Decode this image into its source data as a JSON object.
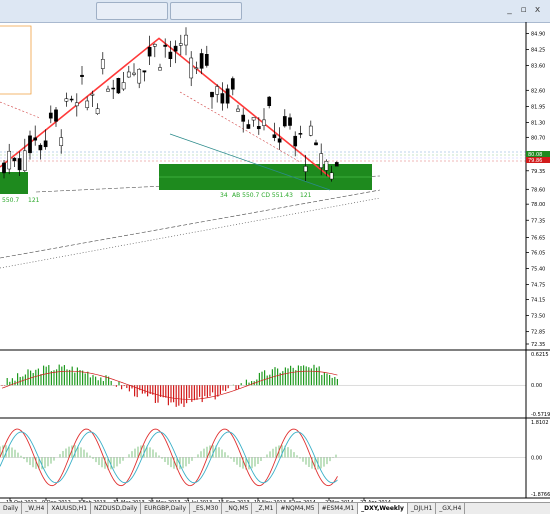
{
  "window": {
    "controls": {
      "minimize": "_",
      "restore": "▫",
      "close": "x"
    }
  },
  "tabs": [
    {
      "label": "Daily"
    },
    {
      "label": "_W,H4"
    },
    {
      "label": "XAUUSD,H1"
    },
    {
      "label": "NZDUSD,Daily"
    },
    {
      "label": "EURGBP,Daily"
    },
    {
      "label": "_ES,M30"
    },
    {
      "label": "_NQ,M5"
    },
    {
      "label": "_Z,M1"
    },
    {
      "label": "#NQM4,M5"
    },
    {
      "label": "#ESM4,M1"
    },
    {
      "label": "_DXY,Weekly",
      "active": true
    },
    {
      "label": "_DJI,H1"
    },
    {
      "label": "_GX,H4"
    }
  ],
  "chart_data": [
    {
      "type": "candlestick",
      "price_axis_ticks": [
        "84.90",
        "84.25",
        "83.60",
        "82.60",
        "81.95",
        "81.30",
        "80.70",
        "80.00",
        "79.35",
        "78.60",
        "78.00",
        "77.35",
        "76.65",
        "76.05",
        "75.40",
        "74.75",
        "74.15",
        "73.50",
        "72.85",
        "72.35"
      ],
      "ylim": [
        72.35,
        85.2
      ],
      "current_price_label_1": "80.08",
      "current_price_label_2": "79.86",
      "annotations": [
        "550.7",
        "121",
        "34",
        "AB 550.7 CD 551.43",
        "121"
      ],
      "zigzag": [
        {
          "date": "Jul 2012",
          "price": 79.5
        },
        {
          "date": "26 May 2013",
          "price": 84.7
        },
        {
          "date": "27 Apr 2014",
          "price": 79.1
        }
      ],
      "colors": {
        "up_candle": "#ffffff",
        "down_candle": "#000000",
        "zigzag": "#ff3a3a",
        "zone": "#1e8a1e"
      }
    },
    {
      "type": "histogram",
      "name": "MACD",
      "axis_ticks": [
        "0.6215",
        "0.00",
        "-0.5719"
      ],
      "ylim": [
        -0.5719,
        0.6215
      ],
      "colors": {
        "positive": "#1f9a1f",
        "negative": "#d21b1b",
        "signal": "#d21b1b"
      }
    },
    {
      "type": "oscillator",
      "axis_ticks": [
        "1.8102",
        "0.00",
        "-1.8766"
      ],
      "ylim": [
        -1.8766,
        1.8102
      ],
      "colors": {
        "line_a": "#e03030",
        "line_b": "#3ab0c8",
        "histogram": "#2a9a2a"
      }
    }
  ],
  "date_axis": [
    "14 Oct 2012",
    "9 Dec 2012",
    "3 Feb 2013",
    "31 Mar 2013",
    "26 May 2013",
    "21 Jul 2013",
    "15 Sep 2013",
    "10 Nov 2013",
    "5 Jan 2014",
    "2 Mar 2014",
    "27 Apr 2014"
  ]
}
